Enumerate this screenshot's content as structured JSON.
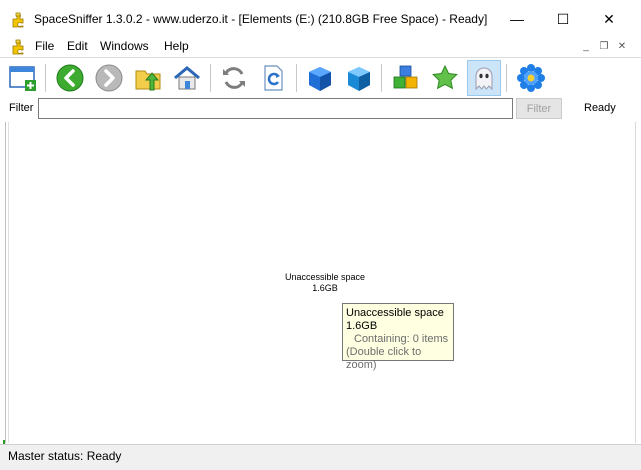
{
  "window": {
    "title": "SpaceSniffer 1.3.0.2 - www.uderzo.it - [Elements (E:) (210.8GB Free Space) - Ready]",
    "min_glyph": "—",
    "max_glyph": "☐",
    "close_glyph": "✕"
  },
  "menu": {
    "items": [
      "File",
      "Edit",
      "Windows",
      "Help"
    ],
    "mdi_min": "_",
    "mdi_restore": "❐",
    "mdi_close": "✕"
  },
  "toolbar": {
    "buttons": [
      "new-view-icon",
      "back-icon",
      "forward-icon",
      "folder-up-icon",
      "home-icon",
      "refresh-icon",
      "refresh-document-icon",
      "blue-box-icon",
      "blue-box-open-icon",
      "colored-boxes-icon",
      "star-icon",
      "ghost-icon",
      "settings-flower-icon"
    ],
    "active": "ghost-icon"
  },
  "filter": {
    "label": "Filter",
    "value": "",
    "button_label": "Filter",
    "status": "Ready"
  },
  "main": {
    "block_name": "Unaccessible space",
    "block_size": "1.6GB"
  },
  "tooltip": {
    "line1": "Unaccessible space",
    "line2": "1.6GB",
    "line3": "Containing: 0 items",
    "line4": "(Double click to zoom)"
  },
  "status": {
    "text": "Master status: Ready"
  },
  "colors": {
    "tooltip_bg": "#ffffe1",
    "active_button_bg": "#cce4f7"
  }
}
